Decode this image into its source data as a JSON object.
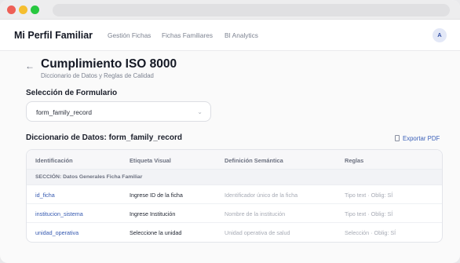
{
  "navbar": {
    "brand": "Mi Perfil Familiar",
    "links": [
      "Gestión Fichas",
      "Fichas Familiares",
      "BI Analytics"
    ],
    "avatar": "A"
  },
  "header": {
    "back_icon": "arrow-left-icon",
    "title": "Cumplimiento ISO 8000",
    "subtitle": "Diccionario de Datos y Reglas de Calidad"
  },
  "form_select": {
    "label": "Selección de Formulario",
    "value": "form_family_record"
  },
  "dictionary": {
    "title": "Diccionario de Datos: form_family_record",
    "export_label": "Exportar PDF",
    "columns": [
      "Identificación",
      "Etiqueta Visual",
      "Definición Semántica",
      "Reglas"
    ],
    "section": "SECCIÓN: Datos Generales Ficha Familiar",
    "rows": [
      {
        "id": "id_ficha",
        "label": "Ingrese ID de la ficha",
        "definition": "Identificador único de la ficha",
        "rules": "Tipo text · Oblig: SÍ"
      },
      {
        "id": "institucion_sistema",
        "label": "Ingrese Institución",
        "definition": "Nombre de la institución",
        "rules": "Tipo text · Oblig: SÍ"
      },
      {
        "id": "unidad_operativa",
        "label": "Seleccione la unidad",
        "definition": "Unidad operativa de salud",
        "rules": "Selección · Oblig: SÍ"
      }
    ]
  },
  "colors": {
    "accent": "#3559b0",
    "traffic_red": "#ee5f56",
    "traffic_yellow": "#f5be2f",
    "traffic_green": "#27c83f"
  }
}
